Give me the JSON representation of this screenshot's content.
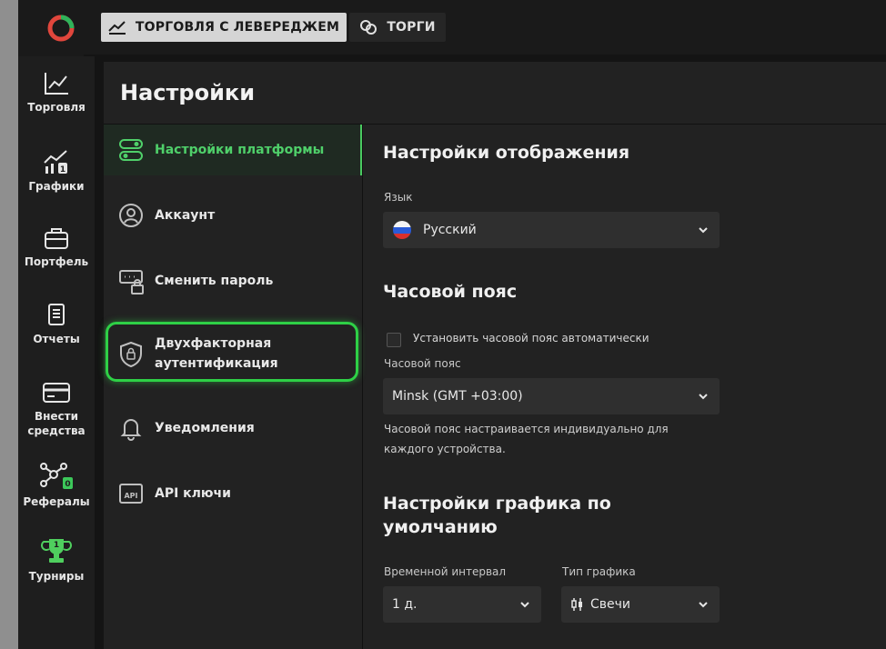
{
  "topbar": {
    "tab_leverage": "ТОРГОВЛЯ С ЛЕВЕРЕДЖЕМ",
    "tab_trades": "ТОРГИ"
  },
  "nav": {
    "items": [
      {
        "label": "Торговля",
        "icon": "chart-line-icon"
      },
      {
        "label": "Графики",
        "icon": "graphs-icon"
      },
      {
        "label": "Портфель",
        "icon": "briefcase-icon"
      },
      {
        "label": "Отчеты",
        "icon": "document-icon"
      },
      {
        "label": "Внести средства",
        "icon": "card-icon"
      },
      {
        "label": "Рефералы",
        "icon": "network-icon",
        "badge": "0"
      },
      {
        "label": "Турниры",
        "icon": "trophy-icon",
        "badge": "1"
      }
    ]
  },
  "page": {
    "title": "Настройки"
  },
  "menu": {
    "items": [
      {
        "label": "Настройки платформы",
        "icon": "toggles-icon",
        "active": true
      },
      {
        "label": "Аккаунт",
        "icon": "user-icon"
      },
      {
        "label": "Сменить пароль",
        "icon": "password-icon"
      },
      {
        "label": "Двухфакторная аутентификация",
        "icon": "shield-lock-icon"
      },
      {
        "label": "Уведомления",
        "icon": "bell-icon"
      },
      {
        "label": "API ключи",
        "icon": "api-icon"
      }
    ]
  },
  "display": {
    "heading": "Настройки отображения",
    "language_label": "Язык",
    "language_value": "Русский"
  },
  "timezone": {
    "heading": "Часовой пояс",
    "auto_label": "Установить часовой пояс автоматически",
    "auto_checked": false,
    "tz_label": "Часовой пояс",
    "tz_value": "Minsk (GMT +03:00)",
    "note_line1": "Часовой пояс настраивается индивидуально для",
    "note_line2": "каждого устройства."
  },
  "chart_defaults": {
    "heading_line1": "Настройки графика по",
    "heading_line2": "умолчанию",
    "interval_label": "Временной интервал",
    "interval_value": "1 д.",
    "type_label": "Тип графика",
    "type_value": "Свечи"
  },
  "colors": {
    "accent": "#4fd06a",
    "highlight": "#2ed046"
  }
}
